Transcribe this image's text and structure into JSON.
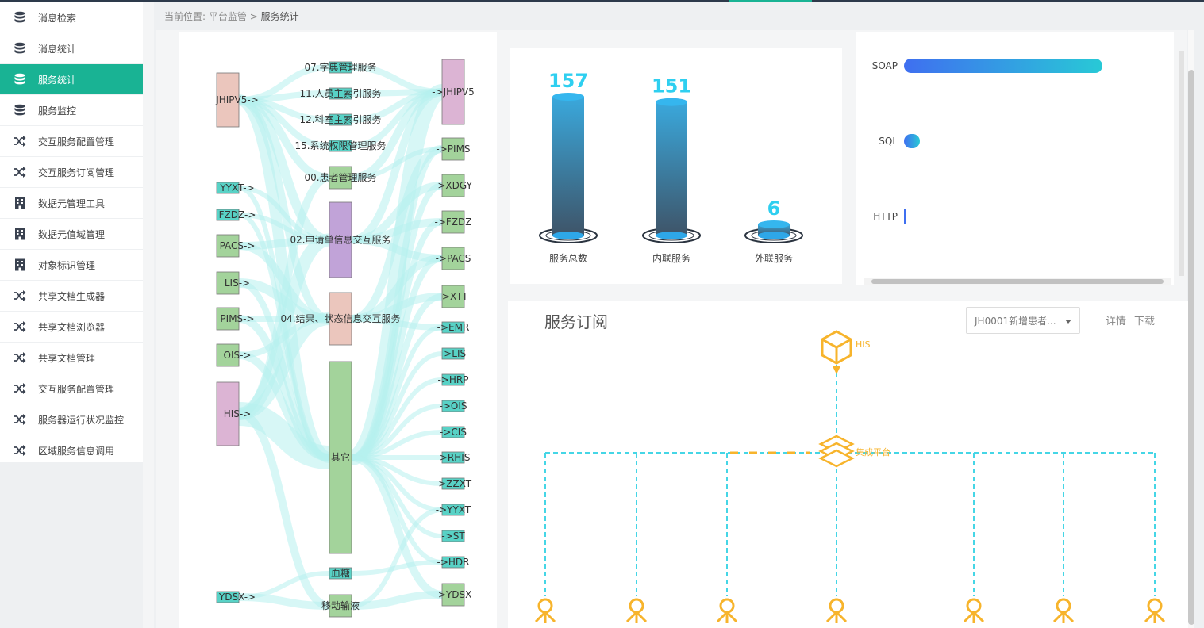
{
  "breadcrumb": {
    "prefix": "当前位置:",
    "parent": "平台监管",
    "sep": ">",
    "current": "服务统计"
  },
  "sidebar": {
    "items": [
      {
        "label": "消息检索",
        "icon": "database-icon"
      },
      {
        "label": "消息统计",
        "icon": "database-icon"
      },
      {
        "label": "服务统计",
        "icon": "database-icon",
        "active": true
      },
      {
        "label": "服务监控",
        "icon": "database-icon"
      },
      {
        "label": "交互服务配置管理",
        "icon": "shuffle-icon"
      },
      {
        "label": "交互服务订阅管理",
        "icon": "shuffle-icon"
      },
      {
        "label": "数据元管理工具",
        "icon": "building-icon"
      },
      {
        "label": "数据元值域管理",
        "icon": "building-icon"
      },
      {
        "label": "对象标识管理",
        "icon": "building-icon"
      },
      {
        "label": "共享文档生成器",
        "icon": "shuffle-icon"
      },
      {
        "label": "共享文档浏览器",
        "icon": "shuffle-icon"
      },
      {
        "label": "共享文档管理",
        "icon": "shuffle-icon"
      },
      {
        "label": "交互服务配置管理",
        "icon": "shuffle-icon"
      },
      {
        "label": "服务器运行状况监控",
        "icon": "shuffle-icon"
      },
      {
        "label": "区域服务信息调用",
        "icon": "shuffle-icon"
      }
    ]
  },
  "sankey": {
    "sources": [
      "JHIPV5->",
      "YYXT->",
      "FZDZ->",
      "PACS->",
      "LIS->",
      "PIMS->",
      "OIS->",
      "HIS->",
      "YDSX->"
    ],
    "services": [
      "07.字典管理服务",
      "11.人员主索引服务",
      "12.科室主索引服务",
      "15.系统权限管理服务",
      "00.患者管理服务",
      "02.申请单信息交互服务",
      "04.结果、状态信息交互服务",
      "其它",
      "血糖",
      "移动输液"
    ],
    "targets": [
      "->JHIPV5",
      "->PIMS",
      "->XDGY",
      "->FZDZ",
      "->PACS",
      "->XTT",
      "->EMR",
      "->LIS",
      "->HRP",
      "->OIS",
      "->CIS",
      "->RHIS",
      "->ZZXT",
      "->YYXT",
      "->ST",
      "->HDR",
      "->YDSX"
    ]
  },
  "chart_data": [
    {
      "type": "bar",
      "categories": [
        "服务总数",
        "内联服务",
        "外联服务"
      ],
      "values": [
        157,
        151,
        6
      ],
      "ylim": [
        0,
        157
      ]
    },
    {
      "type": "bar",
      "orientation": "horizontal",
      "categories": [
        "SOAP",
        "SQL",
        "HTTP"
      ],
      "values": [
        151,
        10,
        0
      ]
    }
  ],
  "subscription": {
    "title": "服务订阅",
    "select_value": "JH0001新增患者...",
    "detail_label": "详情",
    "download_label": "下载",
    "top_node": "HIS",
    "hub_node": "集成平台"
  },
  "colors": {
    "accent": "#19b394",
    "cylinder_value": "#2ecff0",
    "soap_bar_start": "#3f6ff0",
    "soap_bar_end": "#28c9d6",
    "topology_line": "#45d6e6",
    "topology_node": "#f7b42c"
  }
}
